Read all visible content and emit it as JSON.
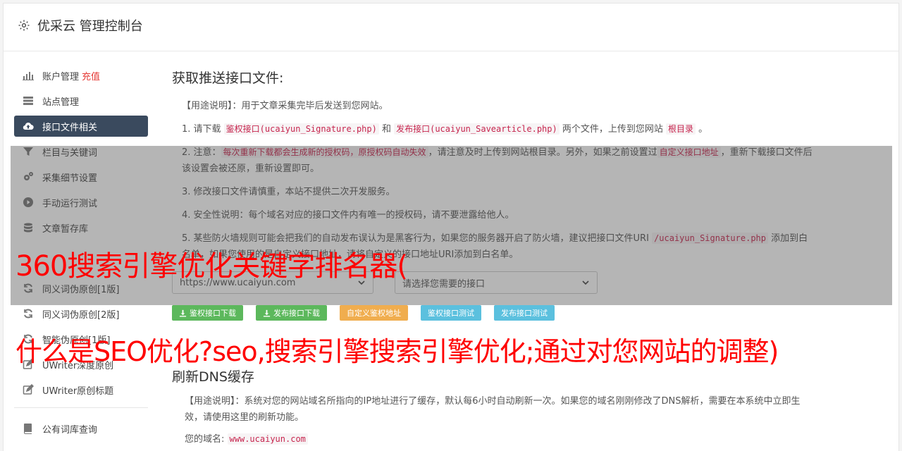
{
  "header": {
    "title": "优采云 管理控制台",
    "icon": "gear-icon"
  },
  "sidebar": {
    "items": [
      {
        "label": "账户管理",
        "badge": "充值",
        "icon": "bar-chart-icon"
      },
      {
        "label": "站点管理",
        "icon": "server-icon"
      },
      {
        "label": "接口文件相关",
        "icon": "cloud-upload-icon",
        "active": true
      },
      {
        "label": "栏目与关键词",
        "icon": "filter-icon"
      },
      {
        "label": "采集细节设置",
        "icon": "gears-icon"
      },
      {
        "label": "手动运行测试",
        "icon": "play-icon"
      },
      {
        "label": "文章暂存库",
        "icon": "database-icon"
      },
      {
        "label": "同义词伪原创[1版]",
        "icon": "refresh-icon"
      },
      {
        "label": "同义词伪原创[2版]",
        "icon": "refresh-icon"
      },
      {
        "label": "智能伪原创[1版]",
        "icon": "refresh-icon"
      },
      {
        "label": "UWriter深度原创",
        "icon": "edit-icon"
      },
      {
        "label": "UWriter原创标题",
        "icon": "edit-icon"
      },
      {
        "label": "公有词库查询",
        "icon": "book-icon"
      }
    ]
  },
  "main": {
    "title": "获取推送接口文件:",
    "usage_label": "【用途说明】",
    "usage_text": "：用于文章采集完毕后发送到您网站。",
    "step1_a": "1. 请下载 ",
    "step1_code1": "鉴权接口(ucaiyun_Signature.php)",
    "step1_b": " 和 ",
    "step1_code2": "发布接口(ucaiyun_Savearticle.php)",
    "step1_c": " 两个文件，上传到您网站 ",
    "step1_code3": "根目录",
    "step1_d": " 。",
    "step2_a": "2. 注意：",
    "step2_code1": "每次重新下载都会生成新的授权码，原授权码自动失效",
    "step2_b": "，请注意及时上传到网站根目录。另外，如果之前设置过",
    "step2_code2": "自定义接口地址",
    "step2_c": "，重新下载接口文件后该设置会被还原，重新设置即可。",
    "step3": "3. 修改接口文件请慎重，本站不提供二次开发服务。",
    "step4": "4. 安全性说明：每个域名对应的接口文件内有唯一的授权码，请不要泄露给他人。",
    "step5_a": "5. 某些防火墙规则可能会把我们的自动发布误认为是黑客行为，如果您的服务器开启了防火墙，建议把接口文件URI ",
    "step5_code": "/ucaiyun_Signature.php",
    "step5_b": " 添加到白名单，如果您使用的是自定义接口地址，请将自定义的接口地址URI添加到白名单。",
    "select_site": "https://www.ucaiyun.com",
    "select_api": "请选择您需要的接口",
    "buttons": {
      "download_auth": "鉴权接口下载",
      "download_publish": "发布接口下载",
      "custom_auth_url": "自定义鉴权地址",
      "test_auth": "鉴权接口测试",
      "test_publish": "发布接口测试"
    }
  },
  "dns": {
    "title": "刷新DNS缓存",
    "usage_label": "【用途说明】",
    "usage_text": "：系统对您的网站域名所指向的IP地址进行了缓存，默认每6小时自动刷新一次。如果您的域名刚刚修改了DNS解析，需要在本系统中立即生效，请使用这里的刷新功能。",
    "domain_label": "您的域名:",
    "domain_value": "www.ucaiyun.com"
  },
  "banners": {
    "line1": "360搜索引擎优化关键字排名器(",
    "line2": "什么是SEO优化?seo,搜索引擎搜索引擎优化;通过对您网站的调整)"
  },
  "colors": {
    "active_nav": "#3a4a5e",
    "red": "#ff0000",
    "green": "#5cb85c",
    "orange": "#f0ad4e",
    "blue": "#5bc0de"
  }
}
